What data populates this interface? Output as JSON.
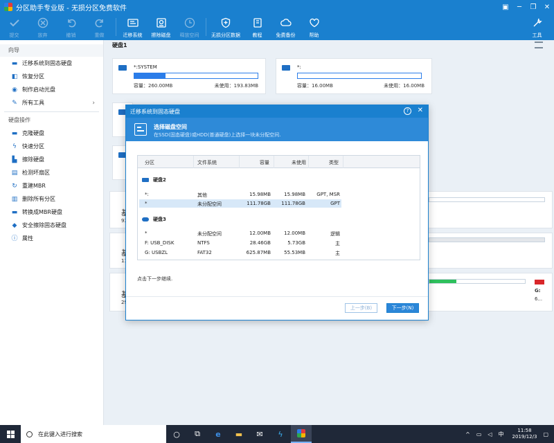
{
  "window": {
    "title": "分区助手专业版 - 无损分区免费软件"
  },
  "toolbar": {
    "commit": "提交",
    "discard": "放弃",
    "undo": "撤销",
    "redo": "重做",
    "migrate": "迁移系统",
    "wipe": "擦除磁盘",
    "clean": "释放空间",
    "lossless": "无损分区数据",
    "tutorial": "教程",
    "backup": "免费备份",
    "help": "帮助",
    "tools": "工具"
  },
  "sidebar": {
    "wizard_head": "向导",
    "wizard_items": [
      "迁移系统到固态硬盘",
      "恢复分区",
      "制作启动光盘",
      "所有工具"
    ],
    "disk_head": "硬盘操作",
    "disk_items": [
      "克隆硬盘",
      "快速分区",
      "擦除硬盘",
      "检测坏扇区",
      "重建MBR",
      "删除所有分区",
      "转换成MBR硬盘",
      "安全擦除固态硬盘",
      "属性"
    ]
  },
  "disk1": {
    "label": "硬盘1",
    "p1": {
      "name": "*:SYSTEM",
      "cap": "容量：260.00MB",
      "free": "未使用：193.83MB",
      "used_fraction": 0.25
    },
    "p2": {
      "name": "*:",
      "cap": "容量：16.00MB",
      "free": "未使用：16.00MB",
      "used_fraction": 0.0
    }
  },
  "lower": {
    "d1_label": "基",
    "d1_size": "93",
    "d2_label": "基",
    "d2_size": "11",
    "d3_label": "基",
    "d3_size": "29",
    "g_label": "G:",
    "g_size": "6..."
  },
  "dialog": {
    "title": "迁移系统到固态硬盘",
    "header_title": "选择磁盘空间",
    "header_sub": "在SSD(固态硬盘)或HDD(普通硬盘)上选择一块未分配空间.",
    "columns": [
      "分区",
      "文件系统",
      "容量",
      "未使用",
      "类型"
    ],
    "disk2_label": "硬盘2",
    "disk2_rows": [
      {
        "part": "*:",
        "fs": "其他",
        "cap": "15.98MB",
        "free": "15.98MB",
        "type": "GPT, MSR"
      },
      {
        "part": "*",
        "fs": "未分配空间",
        "cap": "111.78GB",
        "free": "111.78GB",
        "type": "GPT"
      }
    ],
    "disk3_label": "硬盘3",
    "disk3_rows": [
      {
        "part": "*",
        "fs": "未分配空间",
        "cap": "12.00MB",
        "free": "12.00MB",
        "type": "逻辑"
      },
      {
        "part": "F:  USB_DISK",
        "fs": "NTFS",
        "cap": "28.46GB",
        "free": "5.73GB",
        "type": "主"
      },
      {
        "part": "G:  USBZL",
        "fs": "FAT32",
        "cap": "625.87MB",
        "free": "55.53MB",
        "type": "主"
      }
    ],
    "hint": "点击下一步继续.",
    "prev": "上一步(B)",
    "next": "下一步(N)"
  },
  "taskbar": {
    "search_placeholder": "在此键入进行搜索",
    "ime": "中",
    "time": "11:58",
    "date": "2019/12/3"
  }
}
